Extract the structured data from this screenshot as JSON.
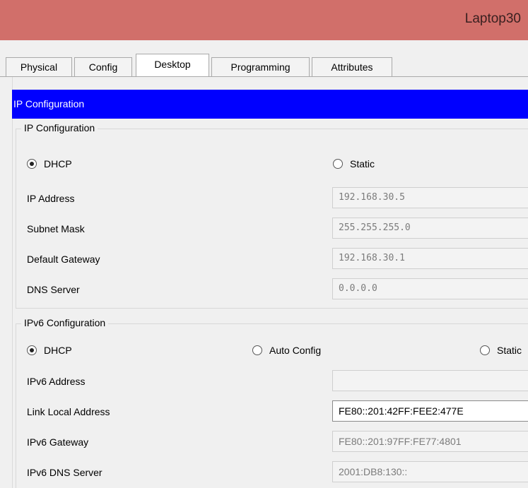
{
  "window": {
    "title": "Laptop30"
  },
  "tabs": [
    {
      "label": "Physical"
    },
    {
      "label": "Config"
    },
    {
      "label": "Desktop"
    },
    {
      "label": "Programming"
    },
    {
      "label": "Attributes"
    }
  ],
  "active_tab": "Desktop",
  "app_header": "IP Configuration",
  "ipv4": {
    "group_title": "IP Configuration",
    "mode_options": [
      {
        "label": "DHCP",
        "checked": true
      },
      {
        "label": "Static",
        "checked": false
      }
    ],
    "fields": [
      {
        "label": "IP Address",
        "value": "192.168.30.5"
      },
      {
        "label": "Subnet Mask",
        "value": "255.255.255.0"
      },
      {
        "label": "Default Gateway",
        "value": "192.168.30.1"
      },
      {
        "label": "DNS Server",
        "value": "0.0.0.0"
      }
    ]
  },
  "ipv6": {
    "group_title": "IPv6 Configuration",
    "mode_options": [
      {
        "label": "DHCP",
        "checked": true
      },
      {
        "label": "Auto Config",
        "checked": false
      },
      {
        "label": "Static",
        "checked": false
      }
    ],
    "fields": [
      {
        "label": "IPv6 Address",
        "value": ""
      },
      {
        "label": "Link Local Address",
        "value": "FE80::201:42FF:FEE2:477E"
      },
      {
        "label": "IPv6 Gateway",
        "value": "FE80::201:97FF:FE77:4801"
      },
      {
        "label": "IPv6 DNS Server",
        "value": "2001:DB8:130::"
      }
    ]
  },
  "colors": {
    "titlebar": "#d16f6a",
    "header": "#0000ff"
  }
}
